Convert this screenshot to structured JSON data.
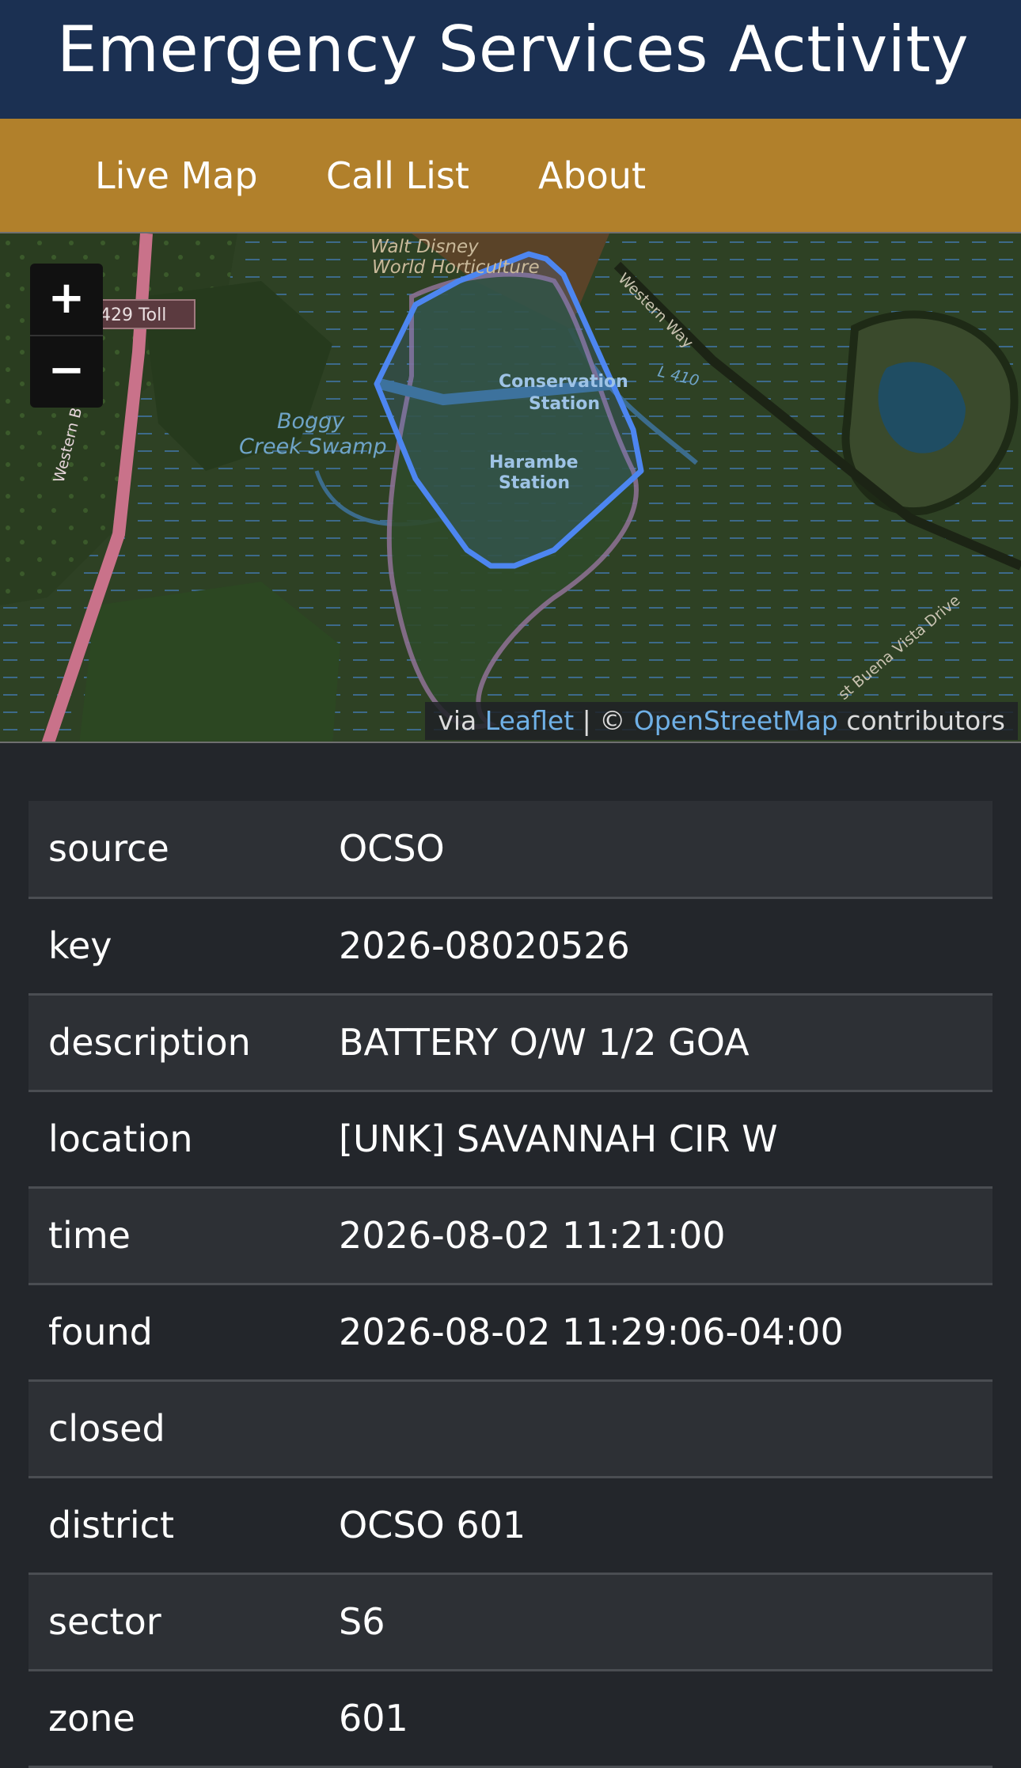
{
  "header": {
    "title": "Emergency Services Activity"
  },
  "nav": {
    "items": [
      "Live Map",
      "Call List",
      "About"
    ]
  },
  "map": {
    "zoom_in": "+",
    "zoom_out": "−",
    "labels": {
      "disney": "Walt Disney",
      "horticulture": "World Horticulture",
      "toll": "429 Toll",
      "western_way": "Western Way",
      "l410": "L 410",
      "conservation_1": "Conservation",
      "conservation_2": "Station",
      "harambe_1": "Harambe",
      "harambe_2": "Station",
      "boggy_1": "Boggy",
      "boggy_2": "Creek Swamp",
      "beltway": "Western Beltway",
      "buena_vista": "st Buena Vista Drive"
    },
    "attribution": {
      "via": "via",
      "leaflet": "Leaflet",
      "sep": "| ©",
      "osm": "OpenStreetMap",
      "contributors": "contributors"
    },
    "colors": {
      "polygon": "#4d86f0",
      "land": "#2f4225",
      "water": "#1f4d63",
      "road": "#c9728a"
    }
  },
  "details": {
    "rows": [
      {
        "key": "source",
        "value": "OCSO"
      },
      {
        "key": "key",
        "value": "2026-08020526"
      },
      {
        "key": "description",
        "value": "BATTERY O/W 1/2 GOA"
      },
      {
        "key": "location",
        "value": "[UNK] SAVANNAH CIR W"
      },
      {
        "key": "time",
        "value": "2026-08-02 11:21:00"
      },
      {
        "key": "found",
        "value": "2026-08-02 11:29:06-04:00"
      },
      {
        "key": "closed",
        "value": ""
      },
      {
        "key": "district",
        "value": "OCSO 601"
      },
      {
        "key": "sector",
        "value": "S6"
      },
      {
        "key": "zone",
        "value": "601"
      }
    ]
  }
}
